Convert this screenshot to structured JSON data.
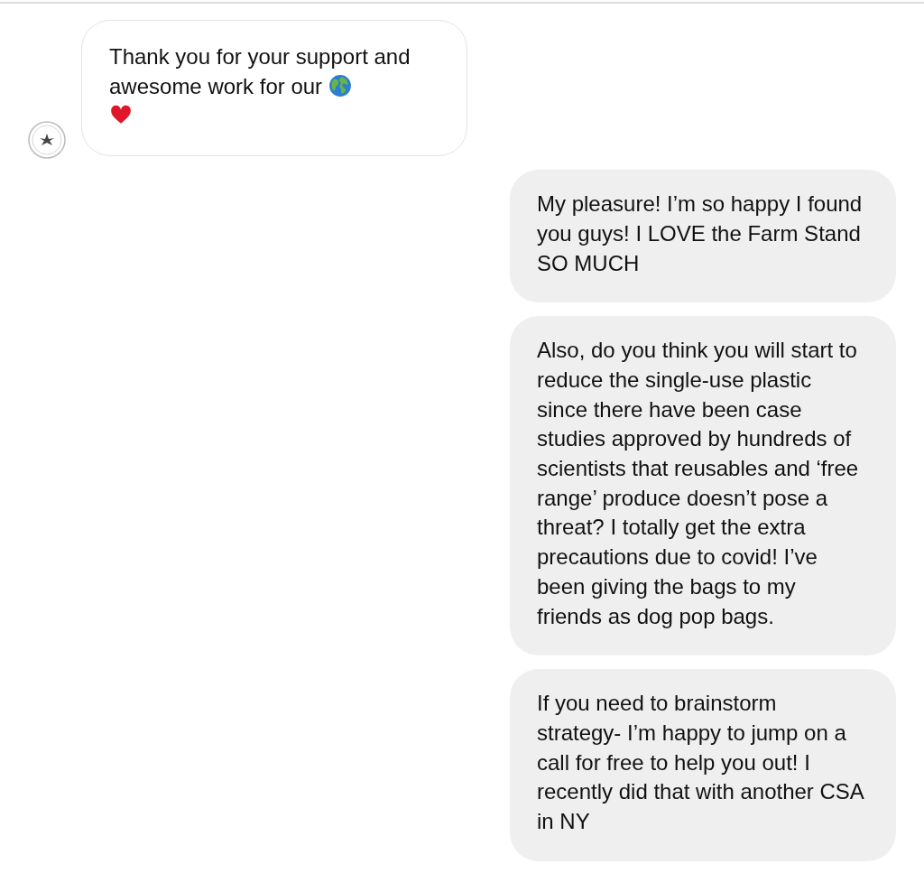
{
  "messages": [
    {
      "kind": "incoming",
      "text": "Thank you for your support and awesome work for our",
      "icons": [
        {
          "kind": "globe"
        },
        {
          "kind": "heart"
        }
      ]
    },
    {
      "kind": "outgoing",
      "text": "My pleasure! I’m so happy I found you guys! I LOVE the Farm Stand SO MUCH"
    },
    {
      "kind": "outgoing",
      "text": "Also, do you think you will start to reduce the single-use plastic since there have been case studies approved by hundreds of scientists that reusables and ‘free range’ produce doesn’t pose a threat? I totally get the extra precautions due to covid! I’ve been giving the bags to my friends as dog pop bags."
    },
    {
      "kind": "outgoing",
      "text": "If you need to brainstorm strategy- I’m happy to jump on a call for free to help you out! I recently did that with another CSA in NY"
    }
  ]
}
